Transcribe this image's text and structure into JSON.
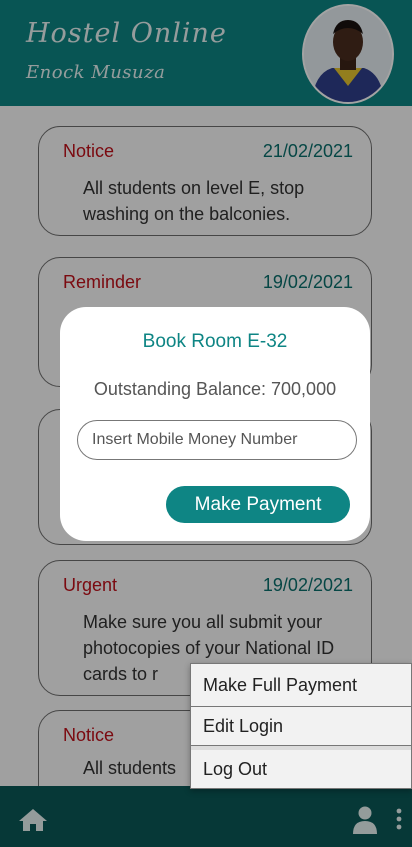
{
  "theme": {
    "brand": "#0e8584",
    "brand_dark": "#0a6f6d",
    "alert": "#c0101a"
  },
  "header": {
    "app_title": "Hostel Online",
    "user_name": "Enock Musuza"
  },
  "notices": [
    {
      "type": "Notice",
      "date": "21/02/2021",
      "message": "All students on level E, stop washing on the balconies."
    },
    {
      "type": "Reminder",
      "date": "19/02/2021",
      "message": ""
    },
    {
      "type": "",
      "date": "",
      "message": ""
    },
    {
      "type": "Urgent",
      "date": "19/02/2021",
      "message": "Make sure you all submit your photocopies of your National ID cards to r"
    },
    {
      "type": "Notice",
      "date": "",
      "message": "All students"
    }
  ],
  "modal": {
    "title": "Book Room E-32",
    "balance_text": "Outstanding Balance: 700,000",
    "input_placeholder": "Insert Mobile Money Number",
    "button_label": "Make Payment"
  },
  "menu": {
    "items": [
      "Make Full Payment",
      "Edit Login",
      "Log Out"
    ]
  },
  "bottom_nav": {
    "icons": [
      "home-icon",
      "user-icon",
      "more-vert-icon"
    ]
  }
}
